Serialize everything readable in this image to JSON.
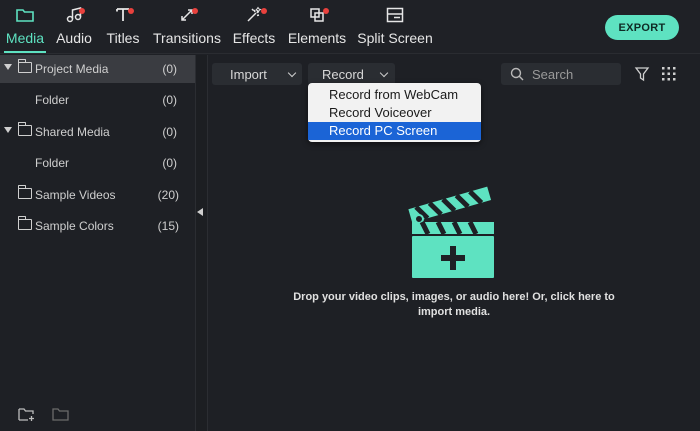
{
  "tabs": [
    {
      "label": "Media",
      "icon": "folder-icon",
      "active": true,
      "dot": false
    },
    {
      "label": "Audio",
      "icon": "music-note-icon",
      "active": false,
      "dot": true
    },
    {
      "label": "Titles",
      "icon": "text-icon",
      "active": false,
      "dot": true
    },
    {
      "label": "Transitions",
      "icon": "transition-icon",
      "active": false,
      "dot": true
    },
    {
      "label": "Effects",
      "icon": "effects-icon",
      "active": false,
      "dot": true
    },
    {
      "label": "Elements",
      "icon": "elements-icon",
      "active": false,
      "dot": true
    },
    {
      "label": "Split Screen",
      "icon": "split-screen-icon",
      "active": false,
      "dot": false
    }
  ],
  "export_label": "EXPORT",
  "sidebar": {
    "items": [
      {
        "name": "Project Media",
        "count": "(0)",
        "expandable": true,
        "selected": true
      },
      {
        "name": "Folder",
        "count": "(0)",
        "expandable": false,
        "selected": false
      },
      {
        "name": "Shared Media",
        "count": "(0)",
        "expandable": true,
        "selected": false
      },
      {
        "name": "Folder",
        "count": "(0)",
        "expandable": false,
        "selected": false
      },
      {
        "name": "Sample Videos",
        "count": "(20)",
        "expandable": false,
        "selected": false
      },
      {
        "name": "Sample Colors",
        "count": "(15)",
        "expandable": false,
        "selected": false
      }
    ]
  },
  "toolbar": {
    "import_label": "Import",
    "record_label": "Record",
    "search_placeholder": "Search"
  },
  "record_menu": {
    "items": [
      "Record from WebCam",
      "Record Voiceover",
      "Record PC Screen"
    ],
    "highlighted_index": 2
  },
  "drop_zone": {
    "text": "Drop your video clips, images, or audio here! Or, click here to import media."
  },
  "colors": {
    "accent": "#5ee2c1",
    "notification_dot": "#e8413d",
    "menu_highlight": "#1b64d6"
  }
}
